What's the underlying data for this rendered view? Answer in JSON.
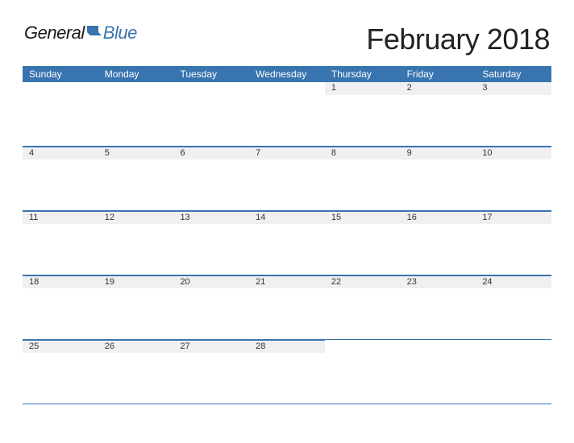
{
  "logo": {
    "part1": "General",
    "part2": "Blue"
  },
  "title": "February 2018",
  "daysOfWeek": [
    "Sunday",
    "Monday",
    "Tuesday",
    "Wednesday",
    "Thursday",
    "Friday",
    "Saturday"
  ],
  "weeks": [
    [
      {
        "n": "",
        "empty": true
      },
      {
        "n": "",
        "empty": true
      },
      {
        "n": "",
        "empty": true
      },
      {
        "n": "",
        "empty": true
      },
      {
        "n": "1"
      },
      {
        "n": "2"
      },
      {
        "n": "3"
      }
    ],
    [
      {
        "n": "4"
      },
      {
        "n": "5"
      },
      {
        "n": "6"
      },
      {
        "n": "7"
      },
      {
        "n": "8"
      },
      {
        "n": "9"
      },
      {
        "n": "10"
      }
    ],
    [
      {
        "n": "11"
      },
      {
        "n": "12"
      },
      {
        "n": "13"
      },
      {
        "n": "14"
      },
      {
        "n": "15"
      },
      {
        "n": "16"
      },
      {
        "n": "17"
      }
    ],
    [
      {
        "n": "18"
      },
      {
        "n": "19"
      },
      {
        "n": "20"
      },
      {
        "n": "21"
      },
      {
        "n": "22"
      },
      {
        "n": "23"
      },
      {
        "n": "24"
      }
    ],
    [
      {
        "n": "25"
      },
      {
        "n": "26"
      },
      {
        "n": "27"
      },
      {
        "n": "28"
      },
      {
        "n": "",
        "empty": true
      },
      {
        "n": "",
        "empty": true
      },
      {
        "n": "",
        "empty": true
      }
    ]
  ]
}
